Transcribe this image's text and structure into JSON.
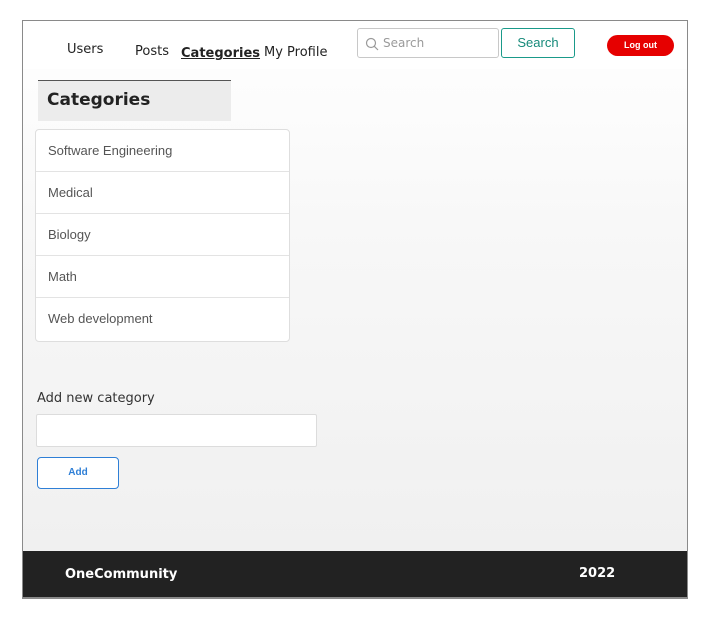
{
  "nav": {
    "links": [
      {
        "label": "Users"
      },
      {
        "label": "Posts"
      },
      {
        "label": "Categories",
        "active": true
      },
      {
        "label": "My Profile"
      }
    ],
    "search": {
      "placeholder": "Search",
      "value": ""
    },
    "search_button": "Search",
    "logout_button": "Log out"
  },
  "main": {
    "title": "Categories",
    "categories": [
      {
        "name": "Software Engineering"
      },
      {
        "name": "Medical"
      },
      {
        "name": "Biology"
      },
      {
        "name": "Math"
      },
      {
        "name": "Web development"
      }
    ],
    "add_form": {
      "label": "Add new category",
      "input_value": "",
      "button_label": "Add"
    }
  },
  "footer": {
    "brand": "OneCommunity",
    "year": "2022"
  },
  "colors": {
    "logout": "#e60000",
    "search_button": "#1a9a8a",
    "add_button": "#2f7fd6",
    "footer_bg": "#222222"
  }
}
